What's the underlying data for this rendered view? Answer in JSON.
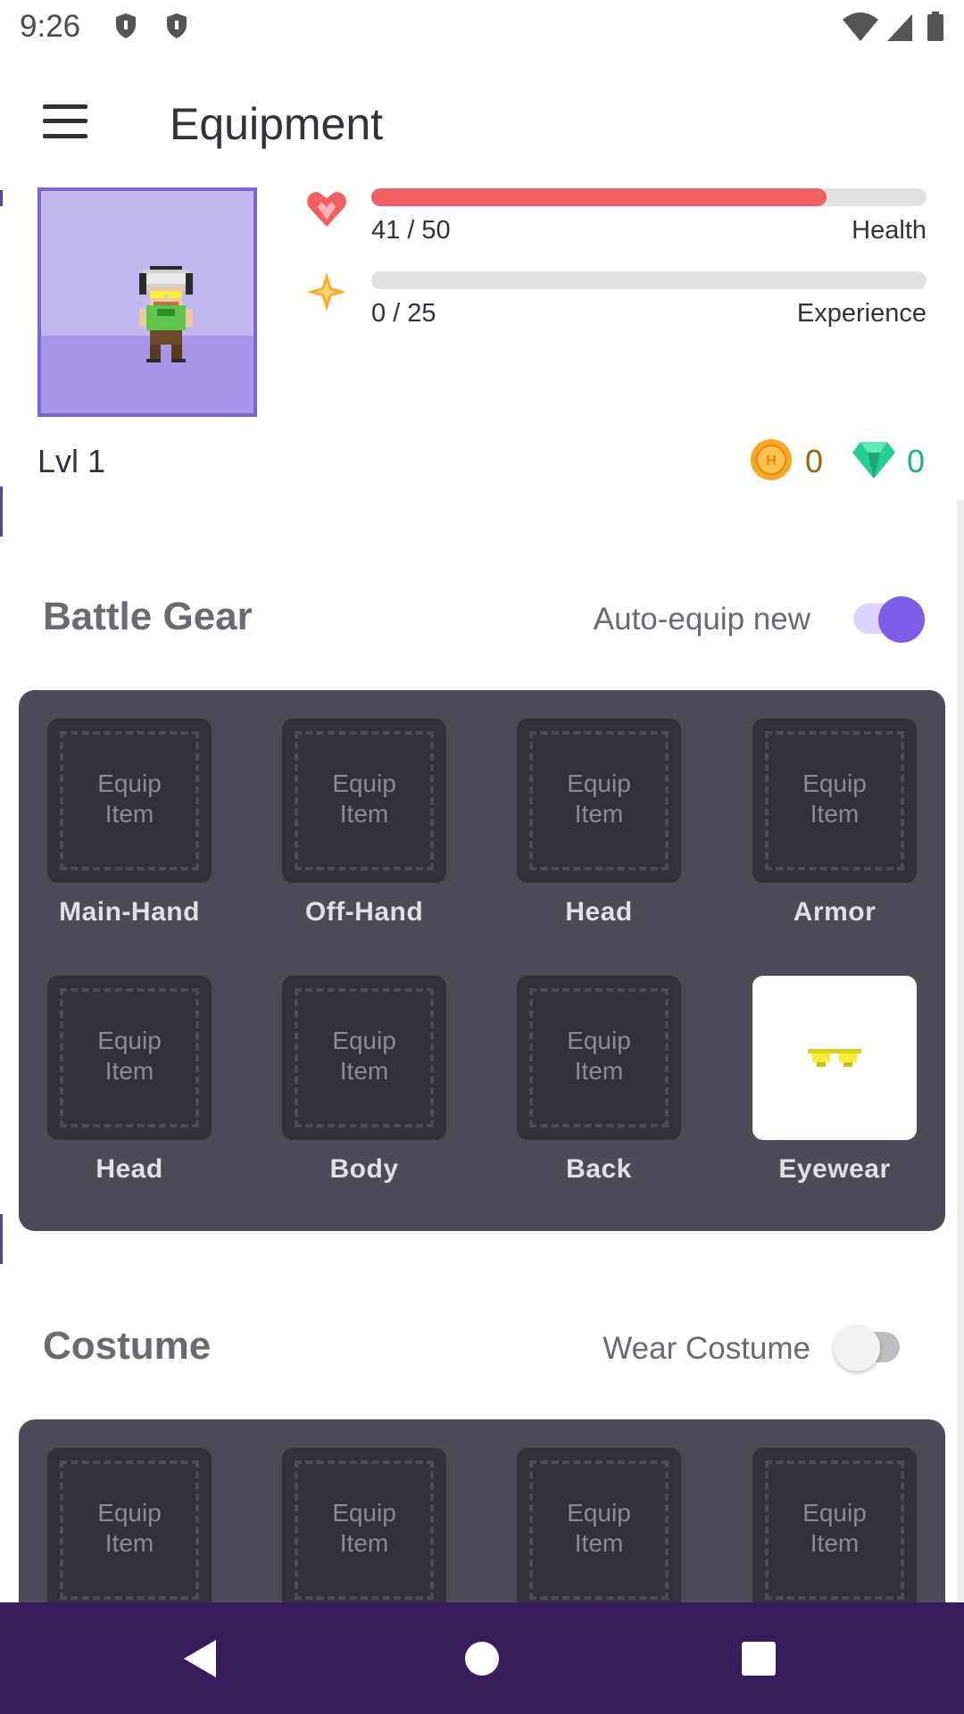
{
  "status_bar": {
    "time": "9:26",
    "icons": [
      "shield-icon",
      "shield-icon",
      "wifi-icon",
      "signal-icon",
      "battery-icon"
    ]
  },
  "app_bar": {
    "menu_icon": "hamburger-menu-icon",
    "title": "Equipment"
  },
  "stats": {
    "health": {
      "value_text": "41 / 50",
      "label": "Health",
      "current": 41,
      "max": 50,
      "color": "#f25f63",
      "icon": "heart-icon"
    },
    "experience": {
      "value_text": "0 / 25",
      "label": "Experience",
      "current": 0,
      "max": 25,
      "color": "#ffa623",
      "icon": "star-icon"
    }
  },
  "level": "Lvl 1",
  "currency": {
    "gold": {
      "value": "0",
      "icon": "gold-coin-icon",
      "color": "#a0660f"
    },
    "gems": {
      "value": "0",
      "icon": "gem-icon",
      "color": "#20b37f"
    }
  },
  "battle_gear": {
    "title": "Battle Gear",
    "toggle_label": "Auto-equip new",
    "toggle_on": true,
    "slots": [
      {
        "text": "Equip Item",
        "label": "Main-Hand"
      },
      {
        "text": "Equip Item",
        "label": "Off-Hand"
      },
      {
        "text": "Equip Item",
        "label": "Head"
      },
      {
        "text": "Equip Item",
        "label": "Armor"
      },
      {
        "text": "Equip Item",
        "label": "Head"
      },
      {
        "text": "Equip Item",
        "label": "Body"
      },
      {
        "text": "Equip Item",
        "label": "Back"
      },
      {
        "text": "",
        "label": "Eyewear",
        "equipped": true,
        "item_icon": "yellow-glasses-icon"
      }
    ]
  },
  "costume": {
    "title": "Costume",
    "toggle_label": "Wear Costume",
    "toggle_on": false,
    "slots": [
      {
        "text": "Equip Item"
      },
      {
        "text": "Equip Item"
      },
      {
        "text": "Equip Item"
      },
      {
        "text": "Equip Item"
      }
    ]
  },
  "nav_bar": {
    "buttons": [
      "back-icon",
      "home-icon",
      "recents-icon"
    ]
  },
  "colors": {
    "accent": "#7d5ce8",
    "panel": "#4e4a57",
    "slot": "#34313a",
    "nav": "#371d5c"
  }
}
